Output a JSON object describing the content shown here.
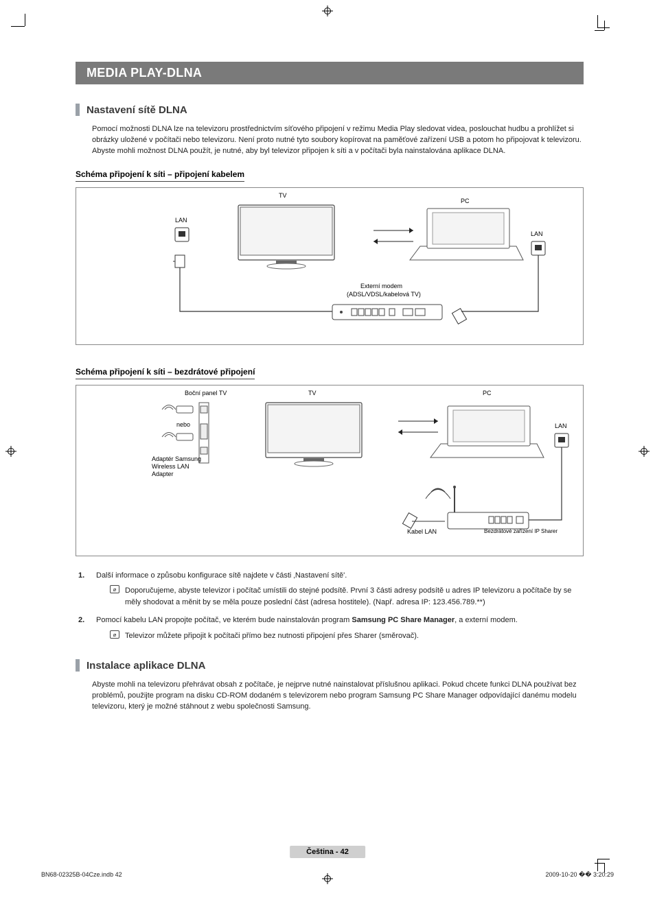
{
  "title_bar": "MEDIA PLAY-DLNA",
  "section1": {
    "heading": "Nastavení sítě DLNA",
    "body": "Pomocí možnosti DLNA lze na televizoru prostřednictvím síťového připojení v režimu Media Play sledovat videa, poslouchat hudbu a prohlížet si obrázky uložené v počítači nebo televizoru. Není proto nutné tyto soubory kopírovat na paměťové zařízení USB a potom ho připojovat k televizoru. Abyste mohli možnost DLNA použít, je nutné, aby byl televizor připojen k síti a v počítači byla nainstalována aplikace DLNA."
  },
  "schema1": {
    "heading": "Schéma připojení k síti – připojení kabelem",
    "labels": {
      "tv": "TV",
      "pc": "PC",
      "lan_left": "LAN",
      "lan_right": "LAN",
      "modem1": "Externí modem",
      "modem2": "(ADSL/VDSL/kabelová TV)"
    }
  },
  "schema2": {
    "heading": "Schéma připojení k síti – bezdrátové připojení",
    "labels": {
      "side_panel": "Boční panel TV",
      "tv": "TV",
      "pc": "PC",
      "nebo": "nebo",
      "adapter1": "Adaptér Samsung",
      "adapter2": "Wireless LAN",
      "adapter3": "Adapter",
      "lan": "LAN",
      "lan_cable": "Kabel LAN",
      "sharer": "Bezdrátové zařízení IP Sharer"
    }
  },
  "list": {
    "item1_num": "1.",
    "item1_text": "Další informace o způsobu konfigurace sítě najdete v části ‚Nastavení sítě'.",
    "item1_note": "Doporučujeme, abyste televizor i počítač umístili do stejné podsítě. První 3 části adresy podsítě u adres IP televizoru a počítače by se měly shodovat a měnit by se měla pouze poslední část (adresa hostitele). (Např. adresa IP: 123.456.789.**)",
    "item2_num": "2.",
    "item2_text_a": "Pomocí kabelu LAN propojte počítač, ve kterém bude nainstalován program ",
    "item2_bold": "Samsung PC Share Manager",
    "item2_text_b": ", a externí modem.",
    "item2_note": "Televizor můžete připojit k počítači přímo bez nutnosti připojení přes Sharer (směrovač)."
  },
  "section2": {
    "heading": "Instalace aplikace DLNA",
    "body": "Abyste mohli na televizoru přehrávat obsah z počítače, je nejprve nutné nainstalovat příslušnou aplikaci. Pokud chcete funkci DLNA používat bez problémů, použijte program na disku CD-ROM dodaném s televizorem nebo program Samsung PC Share Manager odpovídající danému modelu televizoru, který je možné stáhnout z webu společnosti Samsung."
  },
  "footer": {
    "page_tag": "Čeština - 42",
    "file": "BN68-02325B-04Cze.indb   42",
    "date": "2009-10-20   �� 3:20:29"
  }
}
